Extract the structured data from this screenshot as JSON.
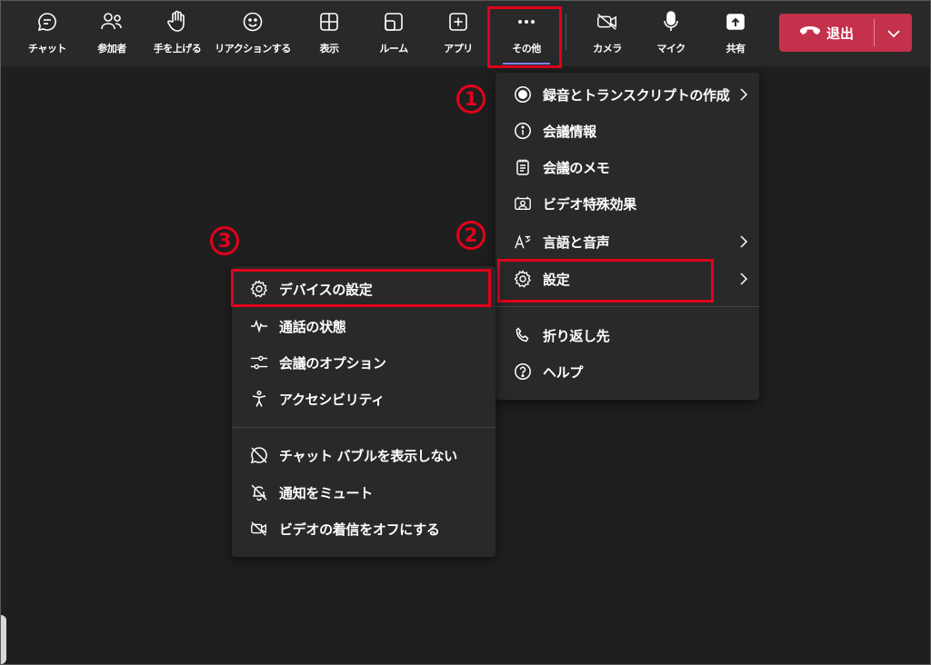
{
  "toolbar": {
    "buttons": [
      {
        "id": "chat",
        "label": "チャット",
        "icon": "chat-icon"
      },
      {
        "id": "people",
        "label": "参加者",
        "icon": "people-icon"
      },
      {
        "id": "raise",
        "label": "手を上げる",
        "icon": "hand-icon"
      },
      {
        "id": "react",
        "label": "リアクションする",
        "icon": "smile-icon"
      },
      {
        "id": "view",
        "label": "表示",
        "icon": "grid-icon"
      },
      {
        "id": "rooms",
        "label": "ルーム",
        "icon": "rooms-icon"
      },
      {
        "id": "apps",
        "label": "アプリ",
        "icon": "plus-square-icon"
      },
      {
        "id": "more",
        "label": "その他",
        "icon": "more-dots-icon",
        "active": true
      },
      {
        "id": "camera",
        "label": "カメラ",
        "icon": "camera-off-icon"
      },
      {
        "id": "mic",
        "label": "マイク",
        "icon": "mic-icon"
      },
      {
        "id": "share",
        "label": "共有",
        "icon": "share-icon"
      }
    ],
    "leave_label": "退出"
  },
  "more_menu": {
    "items": [
      {
        "label": "録音とトランスクリプトの作成",
        "icon": "record-icon",
        "submenu": true
      },
      {
        "label": "会議情報",
        "icon": "info-icon",
        "submenu": false
      },
      {
        "label": "会議のメモ",
        "icon": "notes-icon",
        "submenu": false
      },
      {
        "label": "ビデオ特殊効果",
        "icon": "video-effects-icon",
        "submenu": false
      },
      {
        "label": "言語と音声",
        "icon": "language-icon",
        "submenu": true
      },
      {
        "label": "設定",
        "icon": "gear-icon",
        "submenu": true
      },
      {
        "label": "折り返し先",
        "icon": "phone-icon",
        "submenu": false
      },
      {
        "label": "ヘルプ",
        "icon": "help-icon",
        "submenu": false
      }
    ]
  },
  "settings_menu": {
    "items": [
      {
        "label": "デバイスの設定",
        "icon": "gear-icon"
      },
      {
        "label": "通話の状態",
        "icon": "pulse-icon"
      },
      {
        "label": "会議のオプション",
        "icon": "sliders-icon"
      },
      {
        "label": "アクセシビリティ",
        "icon": "accessibility-icon"
      },
      {
        "label": "チャット バブルを表示しない",
        "icon": "chat-off-icon"
      },
      {
        "label": "通知をミュート",
        "icon": "bell-off-icon"
      },
      {
        "label": "ビデオの着信をオフにする",
        "icon": "video-off-icon"
      }
    ]
  },
  "annotations": {
    "step1": "1",
    "step2": "2",
    "step3": "3"
  },
  "colors": {
    "highlight": "#e3001b",
    "leave_button": "#c4314b",
    "accent": "#7f85f5",
    "menu_bg": "#292929",
    "stage_bg": "#1f1f1f"
  }
}
